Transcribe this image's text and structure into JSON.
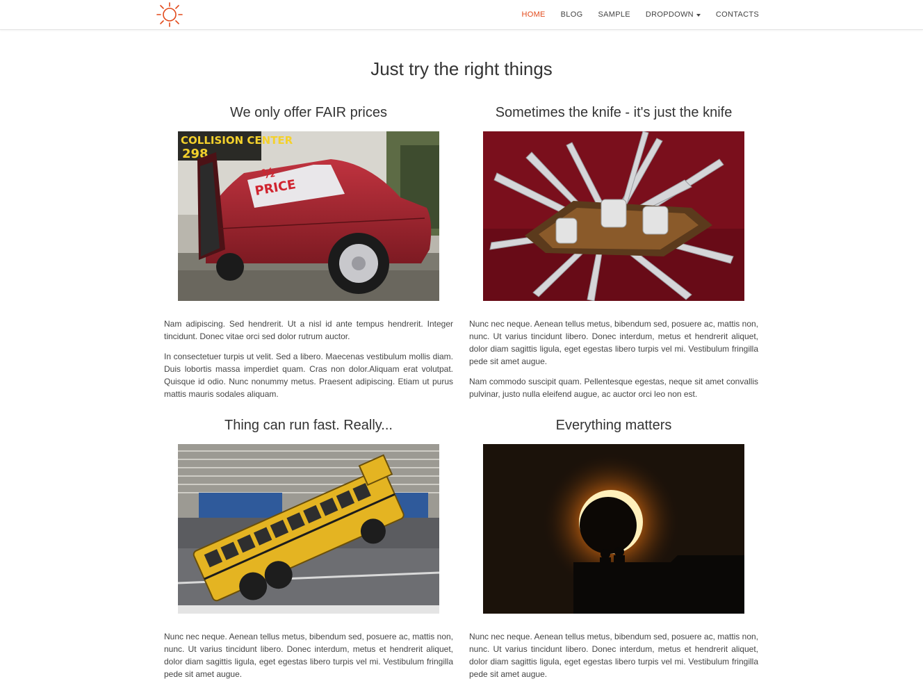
{
  "nav": {
    "items": [
      {
        "label": "HOME",
        "active": true
      },
      {
        "label": "BLOG"
      },
      {
        "label": "SAMPLE"
      },
      {
        "label": "DROPDOWN"
      },
      {
        "label": "CONTACTS"
      }
    ],
    "logo_icon": "sun-icon",
    "accent_color": "#e2491a"
  },
  "page": {
    "title": "Just try the right things"
  },
  "cards": [
    {
      "title": "We only offer FAIR prices",
      "image_icon": "car-photo",
      "sign_text_1": "COLLISION CENTER",
      "sign_text_2": "298",
      "window_text_1": "½",
      "window_text_2": "PRICE",
      "paragraphs": [
        "Nam adipiscing. Sed hendrerit. Ut a nisl id ante tempus hendrerit. Integer tincidunt. Donec vitae orci sed dolor rutrum auctor.",
        "In consectetuer turpis ut velit. Sed a libero. Maecenas vestibulum mollis diam. Duis lobortis massa imperdiet quam. Cras non dolor.Aliquam erat volutpat. Quisque id odio. Nunc nonummy metus. Praesent adipiscing. Etiam ut purus mattis mauris sodales aliquam."
      ]
    },
    {
      "title": "Sometimes the knife - it's just the knife",
      "image_icon": "knife-photo",
      "paragraphs": [
        "Nunc nec neque. Aenean tellus metus, bibendum sed, posuere ac, mattis non, nunc. Ut varius tincidunt libero. Donec interdum, metus et hendrerit aliquet, dolor diam sagittis ligula, eget egestas libero turpis vel mi. Vestibulum fringilla pede sit amet augue.",
        "Nam commodo suscipit quam. Pellentesque egestas, neque sit amet convallis pulvinar, justo nulla eleifend augue, ac auctor orci leo non est."
      ]
    },
    {
      "title": "Thing can run fast. Really...",
      "image_icon": "bus-photo",
      "paragraphs": [
        "Nunc nec neque. Aenean tellus metus, bibendum sed, posuere ac, mattis non, nunc. Ut varius tincidunt libero. Donec interdum, metus et hendrerit aliquet, dolor diam sagittis ligula, eget egestas libero turpis vel mi. Vestibulum fringilla pede sit amet augue."
      ]
    },
    {
      "title": "Everything matters",
      "image_icon": "eclipse-photo",
      "paragraphs": [
        "Nunc nec neque. Aenean tellus metus, bibendum sed, posuere ac, mattis non, nunc. Ut varius tincidunt libero. Donec interdum, metus et hendrerit aliquet, dolor diam sagittis ligula, eget egestas libero turpis vel mi. Vestibulum fringilla pede sit amet augue."
      ]
    }
  ]
}
